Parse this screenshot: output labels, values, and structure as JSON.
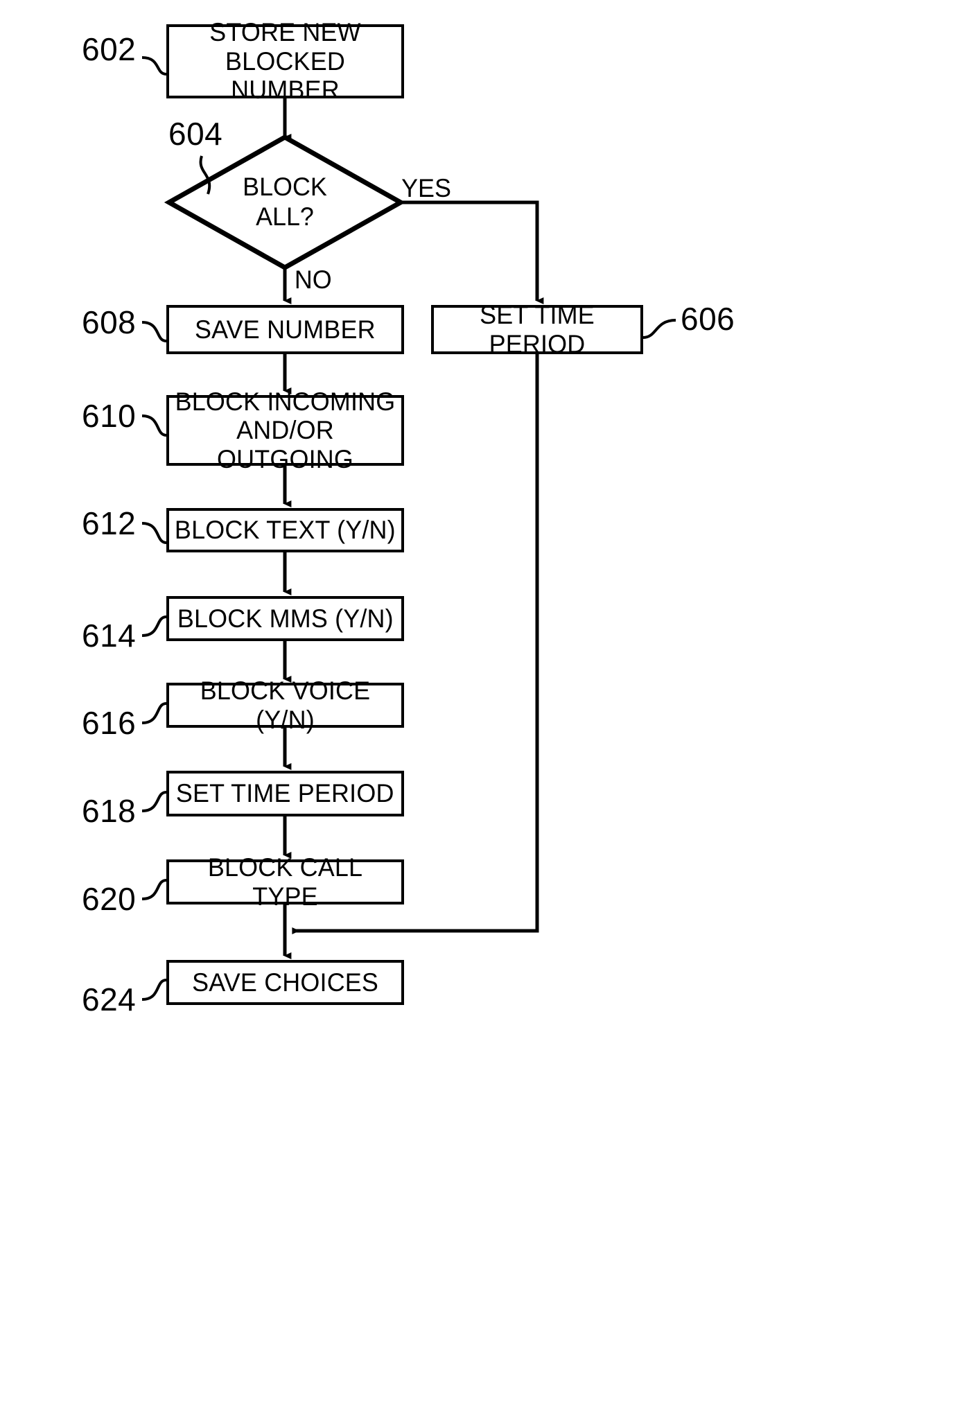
{
  "figure": {
    "title": "Blocked number configuration flowchart",
    "ink_color": "#000000",
    "background_color": "#ffffff"
  },
  "nodes": [
    {
      "id": "602",
      "ref": "602",
      "type": "process",
      "label": "STORE NEW\nBLOCKED NUMBER"
    },
    {
      "id": "604",
      "ref": "604",
      "type": "decision",
      "label": "BLOCK\nALL?"
    },
    {
      "id": "606",
      "ref": "606",
      "type": "process",
      "label": "SET TIME PERIOD"
    },
    {
      "id": "608",
      "ref": "608",
      "type": "process",
      "label": "SAVE NUMBER"
    },
    {
      "id": "610",
      "ref": "610",
      "type": "process",
      "label": "BLOCK INCOMING\nAND/OR OUTGOING"
    },
    {
      "id": "612",
      "ref": "612",
      "type": "process",
      "label": "BLOCK TEXT (Y/N)"
    },
    {
      "id": "614",
      "ref": "614",
      "type": "process",
      "label": "BLOCK MMS (Y/N)"
    },
    {
      "id": "616",
      "ref": "616",
      "type": "process",
      "label": "BLOCK VOICE (Y/N)"
    },
    {
      "id": "618",
      "ref": "618",
      "type": "process",
      "label": "SET TIME PERIOD"
    },
    {
      "id": "620",
      "ref": "620",
      "type": "process",
      "label": "BLOCK CALL TYPE"
    },
    {
      "id": "624",
      "ref": "624",
      "type": "process",
      "label": "SAVE CHOICES"
    }
  ],
  "edges": [
    {
      "from": "602",
      "to": "604",
      "label": ""
    },
    {
      "from": "604",
      "to": "606",
      "label": "YES"
    },
    {
      "from": "604",
      "to": "608",
      "label": "NO"
    },
    {
      "from": "608",
      "to": "610",
      "label": ""
    },
    {
      "from": "610",
      "to": "612",
      "label": ""
    },
    {
      "from": "612",
      "to": "614",
      "label": ""
    },
    {
      "from": "614",
      "to": "616",
      "label": ""
    },
    {
      "from": "616",
      "to": "618",
      "label": ""
    },
    {
      "from": "618",
      "to": "620",
      "label": ""
    },
    {
      "from": "620",
      "to": "624",
      "label": ""
    },
    {
      "from": "606",
      "to": "624",
      "label": ""
    }
  ],
  "edge_labels": {
    "yes": "YES",
    "no": "NO"
  },
  "refs": {
    "n602": "602",
    "n604": "604",
    "n606": "606",
    "n608": "608",
    "n610": "610",
    "n612": "612",
    "n614": "614",
    "n616": "616",
    "n618": "618",
    "n620": "620",
    "n624": "624"
  },
  "labels": {
    "store_new_blocked_number": "STORE NEW\nBLOCKED NUMBER",
    "block_all": "BLOCK\nALL?",
    "set_time_period_606": "SET TIME PERIOD",
    "save_number": "SAVE NUMBER",
    "block_incoming_outgoing": "BLOCK INCOMING\nAND/OR OUTGOING",
    "block_text": "BLOCK TEXT (Y/N)",
    "block_mms": "BLOCK MMS (Y/N)",
    "block_voice": "BLOCK VOICE (Y/N)",
    "set_time_period_618": "SET TIME PERIOD",
    "block_call_type": "BLOCK CALL TYPE",
    "save_choices": "SAVE CHOICES"
  }
}
